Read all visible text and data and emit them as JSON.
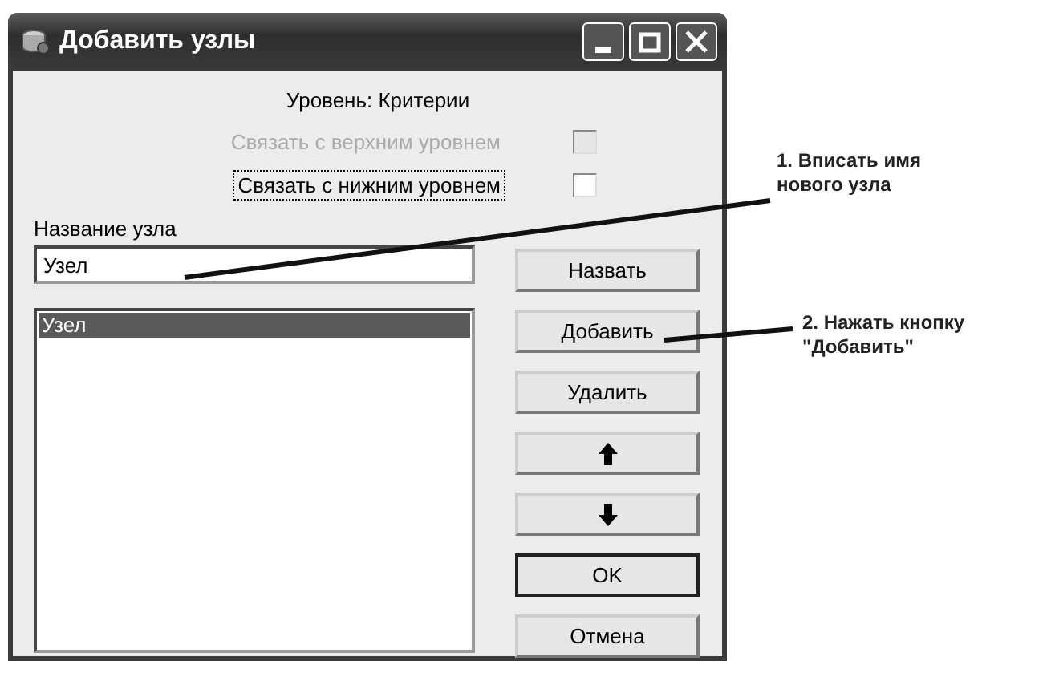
{
  "window": {
    "title": "Добавить узлы"
  },
  "level_label": "Уровень: Критерии",
  "links": [
    {
      "label": "Связать с верхним уровнем",
      "disabled": true,
      "checked": false,
      "focused": false
    },
    {
      "label": "Связать с нижним уровнем",
      "disabled": false,
      "checked": false,
      "focused": true
    }
  ],
  "name_field": {
    "label": "Название узла",
    "value": "Узел"
  },
  "nodes": [
    {
      "label": "Узел",
      "selected": true
    }
  ],
  "buttons": [
    {
      "kind": "text",
      "label": "Назвать",
      "default": false
    },
    {
      "kind": "text",
      "label": "Добавить",
      "default": false
    },
    {
      "kind": "text",
      "label": "Удалить",
      "default": false
    },
    {
      "kind": "up"
    },
    {
      "kind": "down"
    },
    {
      "kind": "text",
      "label": "OK",
      "default": true
    },
    {
      "kind": "text",
      "label": "Отмена",
      "default": false
    }
  ],
  "annotations": [
    {
      "lines": [
        "1. Вписать имя",
        "нового узла"
      ]
    },
    {
      "lines": [
        "2. Нажать кнопку",
        "\"Добавить\""
      ]
    }
  ]
}
